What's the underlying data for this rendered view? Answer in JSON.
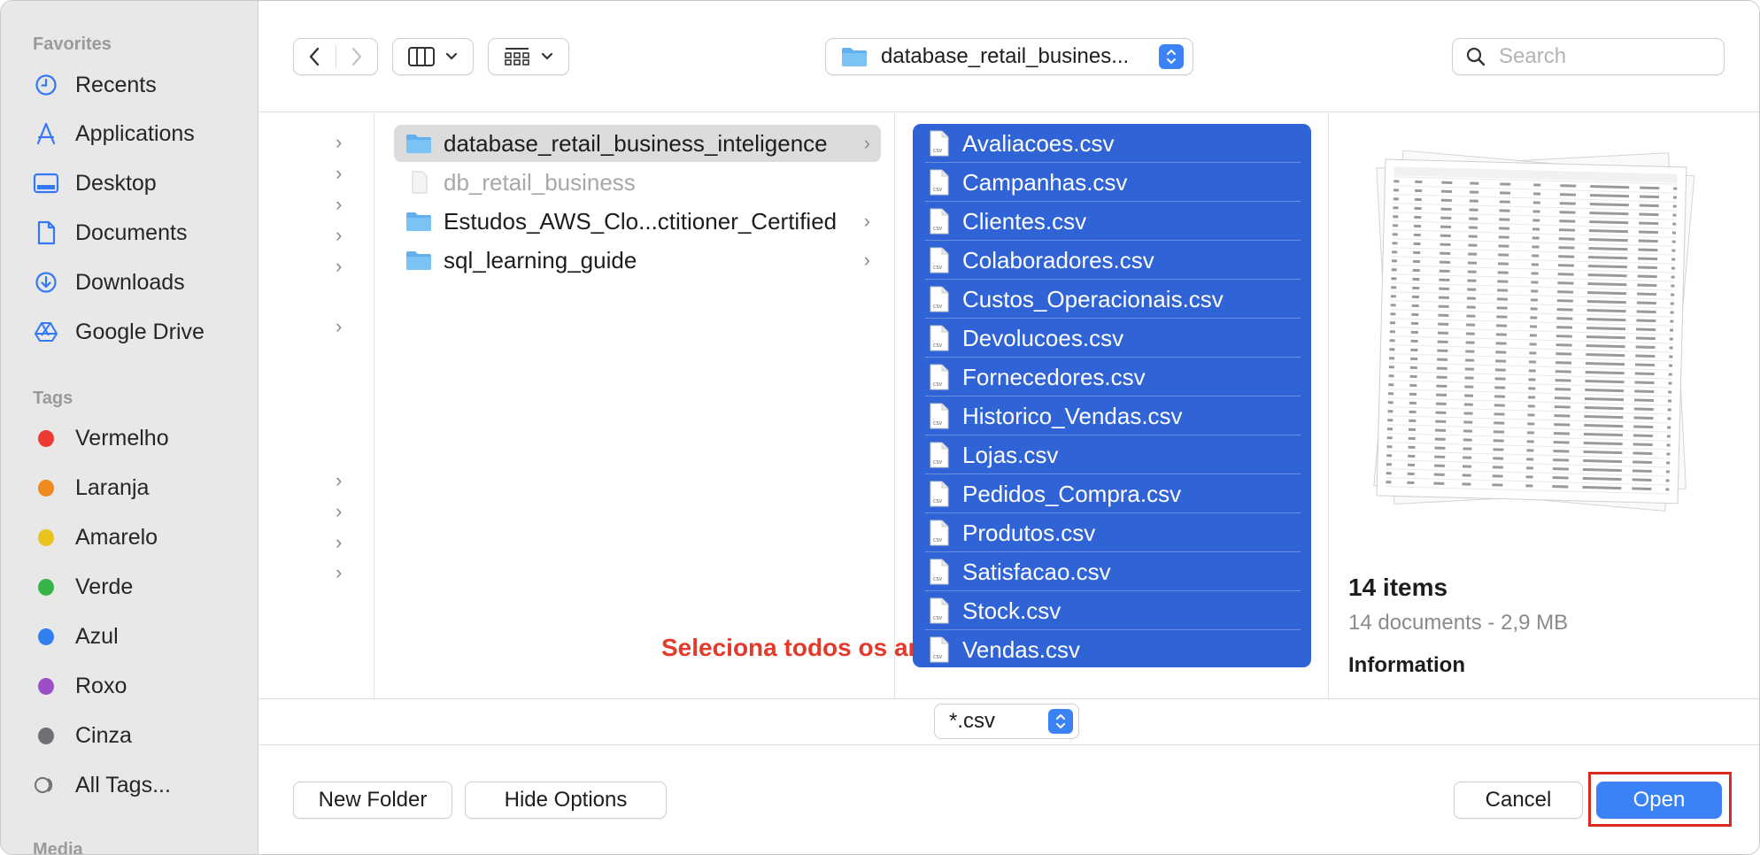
{
  "sidebar": {
    "favorites_title": "Favorites",
    "favorites": [
      {
        "label": "Recents",
        "icon": "clock-icon"
      },
      {
        "label": "Applications",
        "icon": "applications-icon"
      },
      {
        "label": "Desktop",
        "icon": "desktop-icon"
      },
      {
        "label": "Documents",
        "icon": "document-icon"
      },
      {
        "label": "Downloads",
        "icon": "download-icon"
      },
      {
        "label": "Google Drive",
        "icon": "google-drive-icon"
      }
    ],
    "tags_title": "Tags",
    "tags": [
      {
        "label": "Vermelho",
        "color": "#ec3b32"
      },
      {
        "label": "Laranja",
        "color": "#ef8a1f"
      },
      {
        "label": "Amarelo",
        "color": "#e9c21b"
      },
      {
        "label": "Verde",
        "color": "#35b548"
      },
      {
        "label": "Azul",
        "color": "#2f7ff0"
      },
      {
        "label": "Roxo",
        "color": "#9b4ec6"
      },
      {
        "label": "Cinza",
        "color": "#707074"
      }
    ],
    "all_tags": "All Tags...",
    "media_title": "Media"
  },
  "toolbar": {
    "path_label": "database_retail_busines...",
    "search_placeholder": "Search"
  },
  "browser": {
    "folders": [
      {
        "label": "database_retail_business_inteligence",
        "selected": true,
        "dimmed": false,
        "has_children": true
      },
      {
        "label": "db_retail_business",
        "selected": false,
        "dimmed": true,
        "has_children": false
      },
      {
        "label": "Estudos_AWS_Clo...ctitioner_Certified",
        "selected": false,
        "dimmed": false,
        "has_children": true
      },
      {
        "label": "sql_learning_guide",
        "selected": false,
        "dimmed": false,
        "has_children": true
      }
    ],
    "files": [
      "Avaliacoes.csv",
      "Campanhas.csv",
      "Clientes.csv",
      "Colaboradores.csv",
      "Custos_Operacionais.csv",
      "Devolucoes.csv",
      "Fornecedores.csv",
      "Historico_Vendas.csv",
      "Lojas.csv",
      "Pedidos_Compra.csv",
      "Produtos.csv",
      "Satisfacao.csv",
      "Stock.csv",
      "Vendas.csv"
    ],
    "annotation": "Seleciona todos os arquivos",
    "accent_color": "#2f63d6"
  },
  "preview": {
    "title": "14 items",
    "subtitle": "14 documents - 2,9 MB",
    "info_heading": "Information"
  },
  "format": {
    "selected": "*.csv"
  },
  "buttons": {
    "new_folder": "New Folder",
    "hide_options": "Hide Options",
    "cancel": "Cancel",
    "open": "Open"
  }
}
